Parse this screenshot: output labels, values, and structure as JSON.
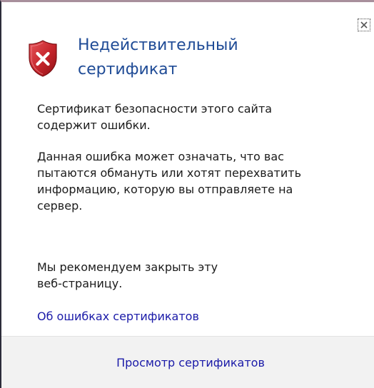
{
  "dialog": {
    "title_line1": "Недействительный",
    "title_line2": "сертификат",
    "paragraph1_line1": "Сертификат безопасности этого сайта",
    "paragraph1_line2": "содержит ошибки.",
    "paragraph2_line1": "Данная ошибка может означать, что вас",
    "paragraph2_line2": "пытаются обмануть или хотят перехватить",
    "paragraph2_line3": "информацию, которую вы отправляете на",
    "paragraph2_line4": "сервер.",
    "paragraph3_line1": "Мы рекомендуем закрыть эту",
    "paragraph3_line2": "веб-страницу.",
    "errors_link": "Об ошибках сертификатов",
    "view_certificates": "Просмотр сертификатов"
  },
  "icons": {
    "shield": "shield-error-icon",
    "close": "close-icon"
  },
  "colors": {
    "title": "#1f4b96",
    "link": "#1a1aa8",
    "shield_red": "#c4242a",
    "footer_bg": "#f2f2f2"
  }
}
